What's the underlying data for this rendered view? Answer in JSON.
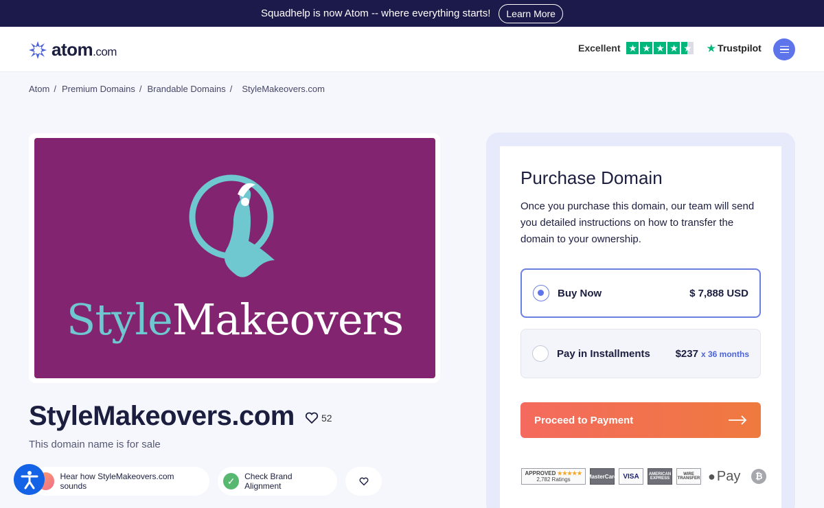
{
  "banner": {
    "text": "Squadhelp is now Atom -- where everything starts!",
    "button": "Learn More"
  },
  "header": {
    "logo_main": "atom",
    "logo_suffix": ".com",
    "trust_label": "Excellent",
    "trust_brand": "Trustpilot",
    "rating_stars": 4.5
  },
  "breadcrumb": [
    "Atom",
    "Premium Domains",
    "Brandable Domains",
    "StyleMakeovers.com"
  ],
  "domain": {
    "brand_part1": "Style",
    "brand_part2": "Makeovers",
    "name": "StyleMakeovers.com",
    "favorites": "52",
    "subtitle": "This domain name is for sale",
    "brand_colors": {
      "background": "#82246f",
      "teal": "#6fc7d0"
    }
  },
  "actions": {
    "sound": "Hear how StyleMakeovers.com sounds",
    "check": "Check Brand Alignment"
  },
  "purchase": {
    "title": "Purchase Domain",
    "description": "Once you purchase this domain, our team will send you detailed instructions on how to transfer the domain to your ownership.",
    "buy_label": "Buy Now",
    "buy_price": "$ 7,888 USD",
    "install_label": "Pay in Installments",
    "install_price": "$237",
    "install_months": "x 36 months",
    "proceed": "Proceed to Payment"
  },
  "payments": {
    "approved": "APPROVED",
    "approved_count": "2,782 Ratings",
    "mastercard": "MasterCard",
    "visa": "VISA",
    "amex": "AMERICAN EXPRESS",
    "wire": "WIRE TRANSFER",
    "applepay": "Pay",
    "bitcoin": "₿"
  }
}
